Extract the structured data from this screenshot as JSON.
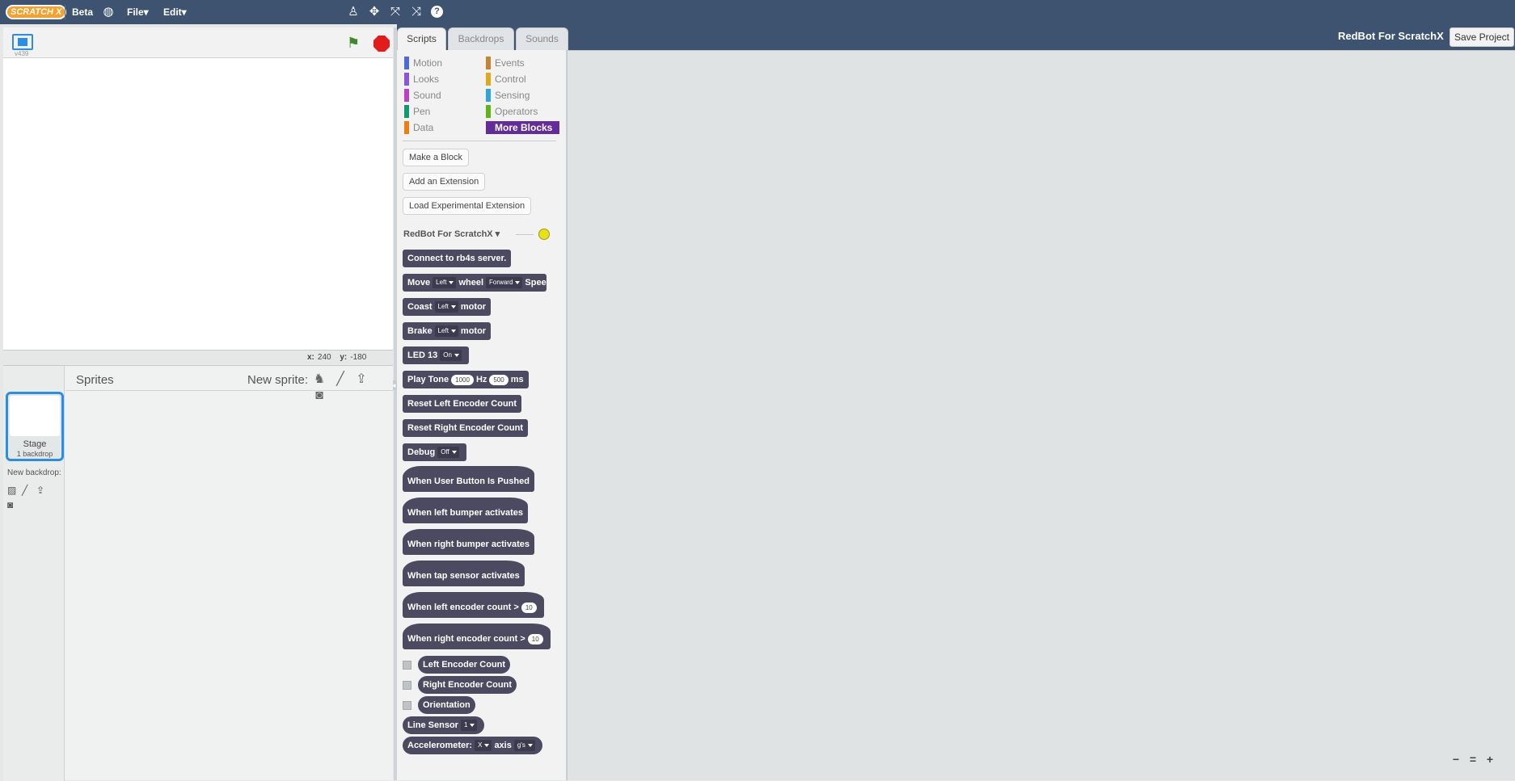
{
  "menubar": {
    "logo": "SCRATCH X",
    "beta": "Beta",
    "file": "File▾",
    "edit": "Edit▾"
  },
  "stage": {
    "version": "v439",
    "coords_x_label": "x:",
    "coords_x": "240",
    "coords_y_label": "y:",
    "coords_y": "-180"
  },
  "sprites": {
    "title": "Sprites",
    "new_sprite": "New sprite:",
    "stage_label": "Stage",
    "stage_count": "1 backdrop",
    "new_backdrop": "New backdrop:"
  },
  "tabs": [
    "Scripts",
    "Backdrops",
    "Sounds"
  ],
  "header": {
    "project_title": "RedBot For ScratchX",
    "save_button": "Save Project"
  },
  "categories": {
    "left": [
      {
        "label": "Motion",
        "color": "#4a6cd4"
      },
      {
        "label": "Looks",
        "color": "#8a55d7"
      },
      {
        "label": "Sound",
        "color": "#bb42c3"
      },
      {
        "label": "Pen",
        "color": "#0e9a6c"
      },
      {
        "label": "Data",
        "color": "#ee7d16"
      }
    ],
    "right": [
      {
        "label": "Events",
        "color": "#c88330"
      },
      {
        "label": "Control",
        "color": "#e1a91a"
      },
      {
        "label": "Sensing",
        "color": "#2ca5e2"
      },
      {
        "label": "Operators",
        "color": "#5cb712"
      },
      {
        "label": "More Blocks",
        "color": "#632d99"
      }
    ]
  },
  "palette_buttons": {
    "make_block": "Make a Block",
    "add_extension": "Add an Extension",
    "load_experimental": "Load Experimental Extension"
  },
  "extension": {
    "name": "RedBot For ScratchX ▾"
  },
  "blocks": {
    "connect": "Connect to rb4s server.",
    "move": {
      "a": "Move",
      "dd1": "Left",
      "b": "wheel",
      "dd2": "Forward",
      "c": "Spee"
    },
    "coast": {
      "a": "Coast",
      "dd": "Left",
      "b": "motor"
    },
    "brake": {
      "a": "Brake",
      "dd": "Left",
      "b": "motor"
    },
    "led": {
      "a": "LED  13",
      "dd": "On"
    },
    "tone": {
      "a": "Play Tone",
      "n1": "1000",
      "b": "Hz",
      "n2": "500",
      "c": "ms"
    },
    "reset_left": "Reset Left Encoder Count",
    "reset_right": "Reset Right Encoder Count",
    "debug": {
      "a": "Debug",
      "dd": "Off"
    },
    "hat_button": "When User Button Is Pushed",
    "hat_left_bumper": "When left bumper activates",
    "hat_right_bumper": "When right bumper activates",
    "hat_tap": "When tap sensor activates",
    "hat_left_enc": {
      "a": "When left encoder count  >",
      "n": "10"
    },
    "hat_right_enc": {
      "a": "When right encoder count  >",
      "n": "10"
    },
    "rep_left_enc": "Left Encoder Count",
    "rep_right_enc": "Right Encoder Count",
    "rep_orientation": "Orientation",
    "line_sensor": {
      "a": "Line Sensor",
      "dd": "1"
    },
    "accel": {
      "a": "Accelerometer:",
      "dd1": "X",
      "b": "axis",
      "dd2": "g's"
    }
  },
  "zoom": {
    "out": "−",
    "reset": "=",
    "in": "+"
  }
}
